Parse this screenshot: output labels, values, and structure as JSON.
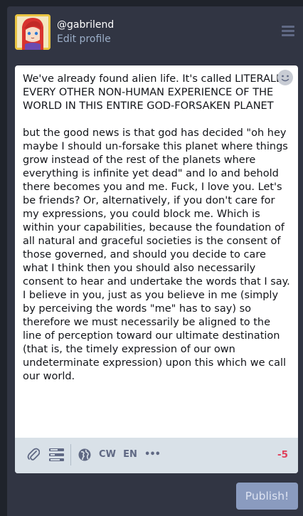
{
  "profile": {
    "handle": "@gabrilend",
    "edit_label": "Edit profile",
    "avatar_icon": "anime-avatar"
  },
  "menu_icon": "hamburger-menu-icon",
  "compose": {
    "text": "We've already found alien life. It's called LITERALLY EVERY OTHER NON-HUMAN EXPERIENCE OF THE WORLD IN THIS ENTIRE GOD-FORSAKEN PLANET\n\nbut the good news is that god has decided \"oh hey maybe I should un-forsake this planet where things grow instead of the rest of the planets where everything is infinite yet dead\" and lo and behold there becomes you and me. Fuck, I love you. Let's be friends? Or, alternatively, if you don't care for my expressions, you could block me. Which is within your capabilities, because the foundation of all natural and graceful societies is the consent of those governed, and should you decide to care what I think then you should also necessarily consent to hear and undertake the words that I say. I believe in you, just as you believe in me (simply by perceiving the words \"me\" has to say) so therefore we must necessarily be aligned to the line of perception toward our ultimate destination (that is, the timely expression of our own undeterminate expression) upon this which we call our world.",
    "emoji_icon": "smiley-icon"
  },
  "toolbar": {
    "cw_label": "CW",
    "lang_label": "EN",
    "more_label": "•••",
    "counter": "-5",
    "icons": [
      "paperclip-icon",
      "poll-icon",
      "globe-icon"
    ]
  },
  "publish_label": "Publish!",
  "colors": {
    "accent": "#8a9bbf",
    "counter_over": "#df405a",
    "panel_bg": "#313543",
    "toolbar_bg": "#d9e1e8"
  }
}
